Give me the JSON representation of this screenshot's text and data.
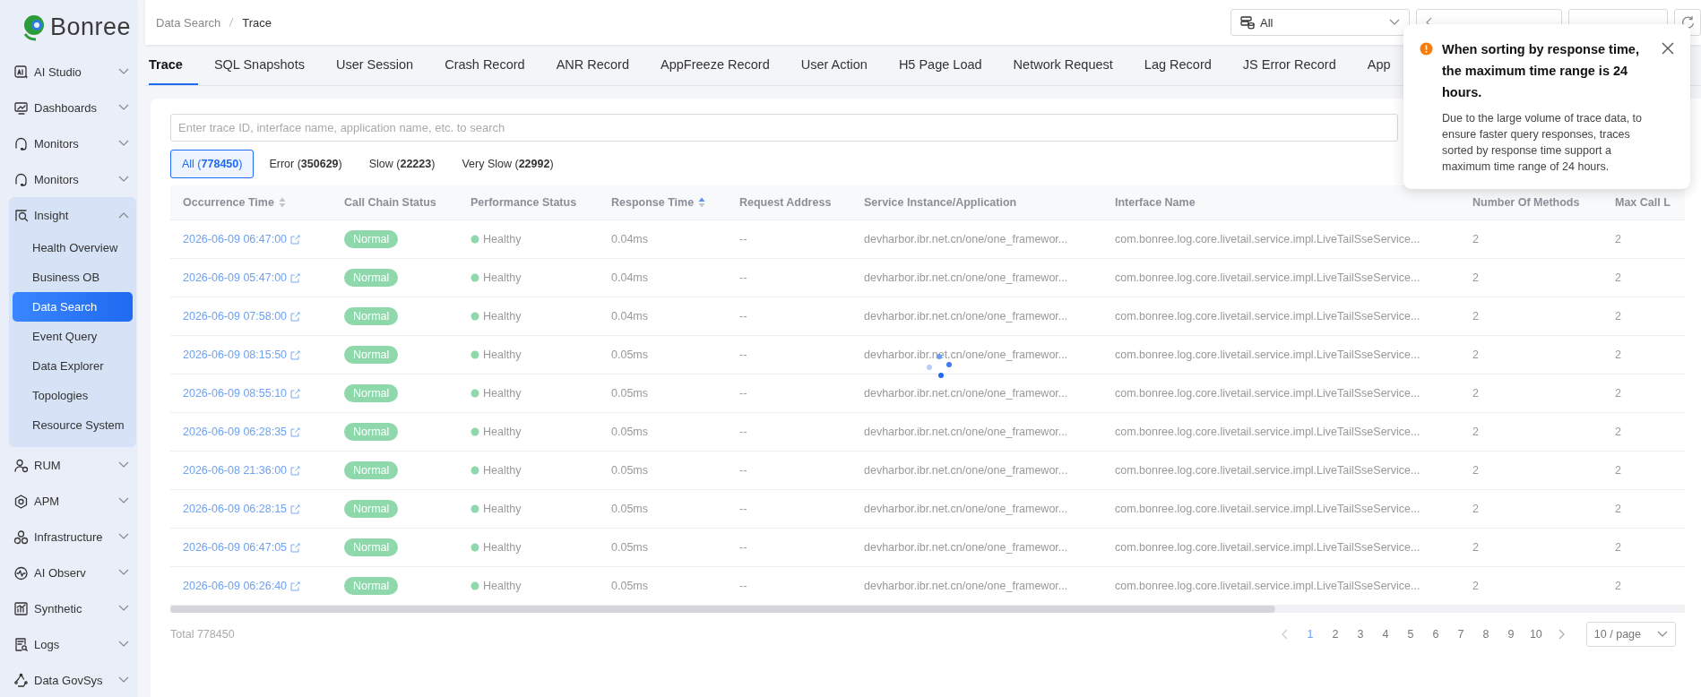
{
  "logo": {
    "text": "Bonree"
  },
  "sidebar": {
    "items": [
      {
        "label": "AI Studio",
        "expanded": false
      },
      {
        "label": "Dashboards",
        "expanded": false
      },
      {
        "label": "Monitors",
        "expanded": false
      },
      {
        "label": "Monitors",
        "expanded": false
      },
      {
        "label": "Insight",
        "expanded": true,
        "children": [
          {
            "label": "Health Overview",
            "selected": false
          },
          {
            "label": "Business OB",
            "selected": false
          },
          {
            "label": "Data Search",
            "selected": true
          },
          {
            "label": "Event Query",
            "selected": false
          },
          {
            "label": "Data Explorer",
            "selected": false
          },
          {
            "label": "Topologies",
            "selected": false
          },
          {
            "label": "Resource System",
            "selected": false
          }
        ]
      },
      {
        "label": "RUM",
        "expanded": false
      },
      {
        "label": "APM",
        "expanded": false
      },
      {
        "label": "Infrastructure",
        "expanded": false
      },
      {
        "label": "AI Observ",
        "expanded": false
      },
      {
        "label": "Synthetic",
        "expanded": false
      },
      {
        "label": "Logs",
        "expanded": false
      },
      {
        "label": "Data GovSys",
        "expanded": false
      }
    ]
  },
  "breadcrumb": [
    "Data Search",
    "Trace"
  ],
  "header_controls": {
    "app_select": "All"
  },
  "tabs": [
    {
      "label": "Trace",
      "selected": true
    },
    {
      "label": "SQL Snapshots",
      "selected": false
    },
    {
      "label": "User Session",
      "selected": false
    },
    {
      "label": "Crash Record",
      "selected": false
    },
    {
      "label": "ANR Record",
      "selected": false
    },
    {
      "label": "AppFreeze Record",
      "selected": false
    },
    {
      "label": "User Action",
      "selected": false
    },
    {
      "label": "H5 Page Load",
      "selected": false
    },
    {
      "label": "Network Request",
      "selected": false
    },
    {
      "label": "Lag Record",
      "selected": false
    },
    {
      "label": "JS Error Record",
      "selected": false
    },
    {
      "label": "App",
      "selected": false
    }
  ],
  "search": {
    "placeholder": "Enter trace ID, interface name, application name, etc. to search"
  },
  "filters": [
    {
      "label": "All (**778450**)",
      "selected": true
    },
    {
      "label": "Error (**350629**)",
      "selected": false
    },
    {
      "label": "Slow (**22223**)",
      "selected": false
    },
    {
      "label": "Very Slow (**22992**)",
      "selected": false
    }
  ],
  "table": {
    "columns": [
      {
        "label": "Occurrence Time",
        "sortable": true,
        "sorted": false
      },
      {
        "label": "Call Chain Status"
      },
      {
        "label": "Performance Status"
      },
      {
        "label": "Response Time",
        "sortable": true,
        "sorted": true
      },
      {
        "label": "Request Address"
      },
      {
        "label": "Service Instance/Application"
      },
      {
        "label": "Interface Name"
      },
      {
        "label": "Number Of Methods"
      },
      {
        "label": "Max Call L"
      }
    ],
    "rows": [
      [
        "2026-06-09 06:47:00",
        "Normal",
        "Healthy",
        "0.04ms",
        "--",
        "devharbor.ibr.net.cn/one/one_framewor...",
        "com.bonree.log.core.livetail.service.impl.LiveTailSseService...",
        "2",
        "2"
      ],
      [
        "2026-06-09 05:47:00",
        "Normal",
        "Healthy",
        "0.04ms",
        "--",
        "devharbor.ibr.net.cn/one/one_framewor...",
        "com.bonree.log.core.livetail.service.impl.LiveTailSseService...",
        "2",
        "2"
      ],
      [
        "2026-06-09 07:58:00",
        "Normal",
        "Healthy",
        "0.04ms",
        "--",
        "devharbor.ibr.net.cn/one/one_framewor...",
        "com.bonree.log.core.livetail.service.impl.LiveTailSseService...",
        "2",
        "2"
      ],
      [
        "2026-06-09 08:15:50",
        "Normal",
        "Healthy",
        "0.05ms",
        "--",
        "devharbor.ibr.net.cn/one/one_framewor...",
        "com.bonree.log.core.livetail.service.impl.LiveTailSseService...",
        "2",
        "2"
      ],
      [
        "2026-06-09 08:55:10",
        "Normal",
        "Healthy",
        "0.05ms",
        "--",
        "devharbor.ibr.net.cn/one/one_framewor...",
        "com.bonree.log.core.livetail.service.impl.LiveTailSseService...",
        "2",
        "2"
      ],
      [
        "2026-06-09 06:28:35",
        "Normal",
        "Healthy",
        "0.05ms",
        "--",
        "devharbor.ibr.net.cn/one/one_framewor...",
        "com.bonree.log.core.livetail.service.impl.LiveTailSseService...",
        "2",
        "2"
      ],
      [
        "2026-06-08 21:36:00",
        "Normal",
        "Healthy",
        "0.05ms",
        "--",
        "devharbor.ibr.net.cn/one/one_framewor...",
        "com.bonree.log.core.livetail.service.impl.LiveTailSseService...",
        "2",
        "2"
      ],
      [
        "2026-06-09 06:28:15",
        "Normal",
        "Healthy",
        "0.05ms",
        "--",
        "devharbor.ibr.net.cn/one/one_framewor...",
        "com.bonree.log.core.livetail.service.impl.LiveTailSseService...",
        "2",
        "2"
      ],
      [
        "2026-06-09 06:47:05",
        "Normal",
        "Healthy",
        "0.05ms",
        "--",
        "devharbor.ibr.net.cn/one/one_framewor...",
        "com.bonree.log.core.livetail.service.impl.LiveTailSseService...",
        "2",
        "2"
      ],
      [
        "2026-06-09 06:26:40",
        "Normal",
        "Healthy",
        "0.05ms",
        "--",
        "devharbor.ibr.net.cn/one/one_framewor...",
        "com.bonree.log.core.livetail.service.impl.LiveTailSseService...",
        "2",
        "2"
      ]
    ],
    "loading": true
  },
  "footer": {
    "total": "Total 778450",
    "pages": [
      {
        "label": "1",
        "selected": true
      },
      {
        "label": "2",
        "selected": false
      },
      {
        "label": "3",
        "selected": false
      },
      {
        "label": "4",
        "selected": false
      },
      {
        "label": "5",
        "selected": false
      },
      {
        "label": "6",
        "selected": false
      },
      {
        "label": "7",
        "selected": false
      },
      {
        "label": "8",
        "selected": false
      },
      {
        "label": "9",
        "selected": false
      },
      {
        "label": "10",
        "selected": false
      }
    ],
    "page_size": "10 / page"
  },
  "notification": {
    "title": "When sorting by response time, the maximum time range is 24 hours.",
    "body": "Due to the large volume of trace data, to ensure faster query responses, traces sorted by response time support a maximum time range of 24 hours."
  }
}
